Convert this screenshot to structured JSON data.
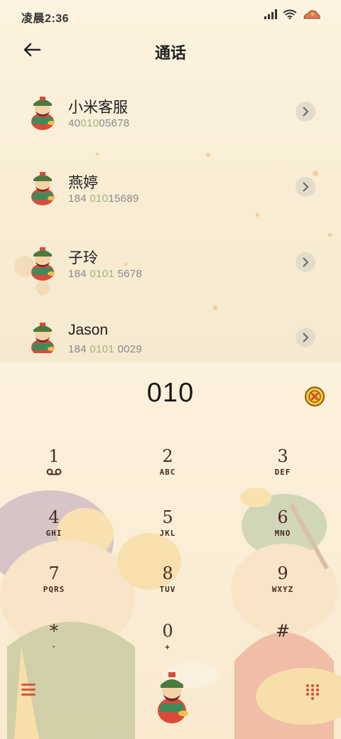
{
  "status_bar": {
    "time": "凌晨2:36",
    "icons": [
      "signal-icon",
      "wifi-icon",
      "battery-icon"
    ]
  },
  "header": {
    "title": "通话",
    "back_icon": "back-arrow-icon"
  },
  "contacts": [
    {
      "name": "小米客服",
      "number_pre": "40",
      "number_hl": "010",
      "number_post": "05678"
    },
    {
      "name": "燕婷",
      "number_pre": "184 ",
      "number_hl": "010",
      "number_post": "15689"
    },
    {
      "name": "子玲",
      "number_pre": "184 ",
      "number_hl": "0101",
      "number_post": " 5678"
    },
    {
      "name": "Jason",
      "number_pre": "184 ",
      "number_hl": "0101",
      "number_post": " 0029"
    }
  ],
  "dialer": {
    "number": "010",
    "keys": [
      {
        "digit": "1",
        "letters": ""
      },
      {
        "digit": "2",
        "letters": "ABC"
      },
      {
        "digit": "3",
        "letters": "DEF"
      },
      {
        "digit": "4",
        "letters": "GHI"
      },
      {
        "digit": "5",
        "letters": "JKL"
      },
      {
        "digit": "6",
        "letters": "MNO"
      },
      {
        "digit": "7",
        "letters": "PQRS"
      },
      {
        "digit": "8",
        "letters": "TUV"
      },
      {
        "digit": "9",
        "letters": "WXYZ"
      },
      {
        "digit": "*",
        "letters": "·"
      },
      {
        "digit": "0",
        "letters": "+"
      },
      {
        "digit": "#",
        "letters": ""
      }
    ]
  },
  "colors": {
    "background": "#fbf0d9",
    "highlight": "#a3b27c",
    "key_text": "#4a2a22",
    "accent_red": "#d9573d"
  }
}
